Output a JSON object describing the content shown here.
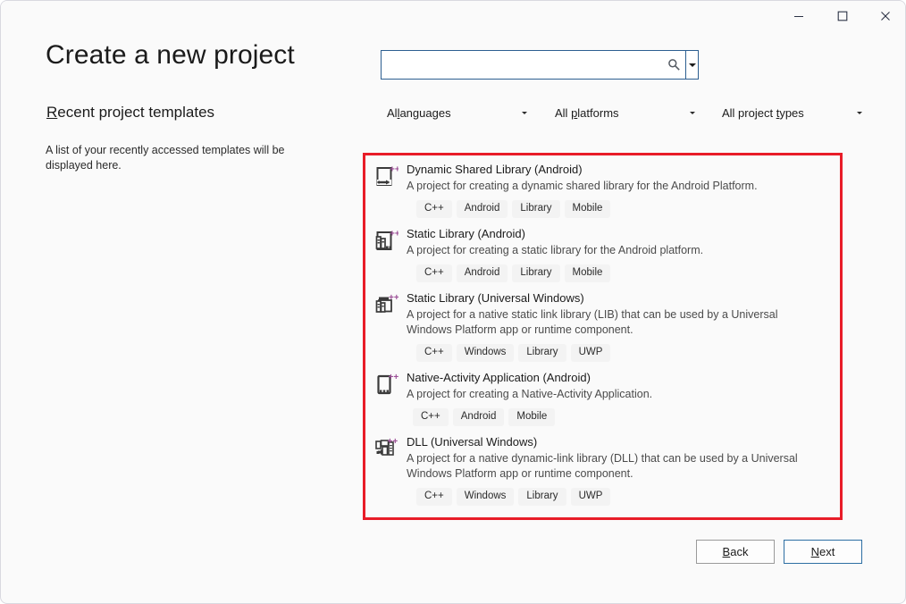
{
  "window": {
    "controls": [
      {
        "name": "minimize",
        "label": "Minimize"
      },
      {
        "name": "maximize",
        "label": "Maximize"
      },
      {
        "name": "close",
        "label": "Close"
      }
    ]
  },
  "left": {
    "page_title": "Create a new project",
    "recent_heading_accel": "R",
    "recent_heading_rest": "ecent project templates",
    "recent_empty_text": "A list of your recently accessed templates will be displayed here."
  },
  "search": {
    "value": "",
    "placeholder": "",
    "icon": "search-icon",
    "dropdown_icon": "chevron-down-icon"
  },
  "filters": [
    {
      "name": "all-languages",
      "accel": "l",
      "before": "Al",
      "after": "anguages",
      "value": "All languages"
    },
    {
      "name": "all-platforms",
      "accel": "p",
      "before": "All ",
      "after": "latforms",
      "value": "All platforms"
    },
    {
      "name": "all-project-types",
      "accel": "t",
      "before": "All project ",
      "after": "ypes",
      "value": "All project types"
    }
  ],
  "highlight": {
    "color": "#e81c28"
  },
  "templates": [
    {
      "icon": "dynamic-shared-library-android-icon",
      "title": "Dynamic Shared Library (Android)",
      "description": "A project for creating a dynamic shared library for the Android Platform.",
      "tags": [
        "C++",
        "Android",
        "Library",
        "Mobile"
      ]
    },
    {
      "icon": "static-library-android-icon",
      "title": "Static Library (Android)",
      "description": "A project for creating a static library for the Android platform.",
      "tags": [
        "C++",
        "Android",
        "Library",
        "Mobile"
      ]
    },
    {
      "icon": "static-library-uwp-icon",
      "title": "Static Library (Universal Windows)",
      "description": "A project for a native static link library (LIB) that can be used by a Universal Windows Platform app or runtime component.",
      "tags": [
        "C++",
        "Windows",
        "Library",
        "UWP"
      ]
    },
    {
      "icon": "native-activity-application-android-icon",
      "title": "Native-Activity Application (Android)",
      "description": "A project for creating a Native-Activity Application.",
      "tags": [
        "C++",
        "Android",
        "Mobile"
      ]
    },
    {
      "icon": "dll-uwp-icon",
      "title": "DLL (Universal Windows)",
      "description": "A project for a native dynamic-link library (DLL) that can be used by a Universal Windows Platform app or runtime component.",
      "tags": [
        "C++",
        "Windows",
        "Library",
        "UWP"
      ]
    }
  ],
  "footer": {
    "back": {
      "accel": "B",
      "rest": "ack",
      "label": "Back"
    },
    "next": {
      "accel": "N",
      "rest": "ext",
      "label": "Next"
    }
  },
  "colors": {
    "window_bg": "#fafafa",
    "accent_blue": "#2d6ea3",
    "highlight_red": "#e81c28",
    "icon_purple": "#9b4f96",
    "icon_dark": "#3a3a3a"
  }
}
